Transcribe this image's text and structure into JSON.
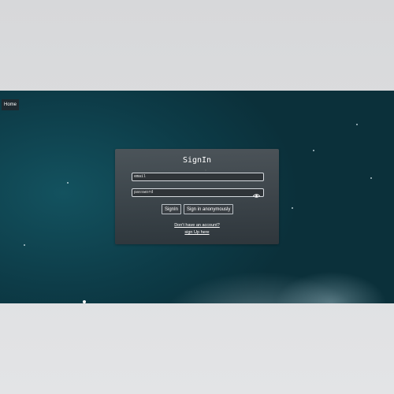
{
  "nav": {
    "home_label": "Home"
  },
  "signin": {
    "title": "SignIn",
    "email_placeholder": "email",
    "password_placeholder": "password",
    "signin_button": "SignIn",
    "anonymous_button": "Sign in anonymously",
    "no_account_text": "Don't have an account?",
    "signup_link": "sign Up here"
  },
  "icons": {
    "password_toggle": "eye-icon"
  },
  "colors": {
    "card_bg": "#3d4247",
    "field_border": "#d6dbe0",
    "sky_dark": "#0b303a",
    "sky_teal": "#13525f"
  }
}
